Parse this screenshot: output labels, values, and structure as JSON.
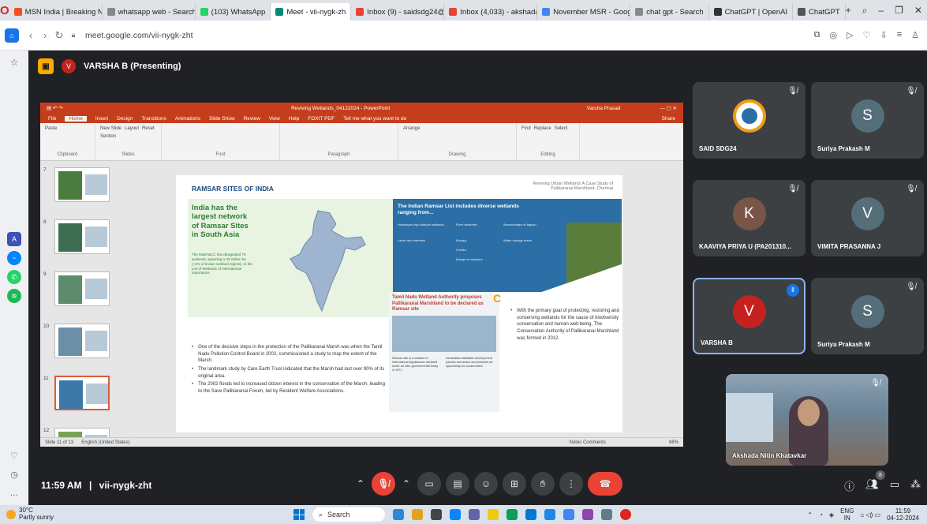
{
  "browser": {
    "tabs": [
      {
        "label": "MSN India | Breaking Ne",
        "color": "#f25022"
      },
      {
        "label": "whatsapp web - Search",
        "color": "#888888"
      },
      {
        "label": "(103) WhatsApp",
        "color": "#25d366"
      },
      {
        "label": "Meet - vii-nygk-zh",
        "color": "#00897b"
      },
      {
        "label": "Inbox (9) - saidsdg24@",
        "color": "#ea4335"
      },
      {
        "label": "Inbox (4,033) - akshada",
        "color": "#ea4335"
      },
      {
        "label": "November MSR - Goog",
        "color": "#4285f4"
      },
      {
        "label": "chat gpt - Search",
        "color": "#888888"
      },
      {
        "label": "ChatGPT | OpenAI",
        "color": "#333333"
      },
      {
        "label": "ChatGPT",
        "color": "#555555"
      }
    ],
    "url": "meet.google.com/vii-nygk-zht"
  },
  "presenting": {
    "initial": "V",
    "label": "VARSHA B (Presenting)"
  },
  "ppt": {
    "window_title": "Reviving Wetlands_04122024 - PowerPoint",
    "user": "Varsha Prasad",
    "menu": [
      "File",
      "Home",
      "Insert",
      "Design",
      "Transitions",
      "Animations",
      "Slide Show",
      "Review",
      "View",
      "Help",
      "FOXIT PDF",
      "Tell me what you want to do"
    ],
    "share": "Share",
    "ribbon_groups": [
      "Clipboard",
      "Slides",
      "Font",
      "Paragraph",
      "Drawing",
      "Editing"
    ],
    "ribbon_items": {
      "paste": "Paste",
      "new_slide": "New Slide",
      "layout": "Layout",
      "reset": "Reset",
      "section": "Section",
      "arrange": "Arrange",
      "find": "Find",
      "replace": "Replace",
      "select": "Select"
    },
    "thumb_numbers": [
      "7",
      "8",
      "9",
      "10",
      "11",
      "12"
    ],
    "status_left": "Slide 11 of 13",
    "status_lang": "English (United States)",
    "status_right": "Notes   Comments",
    "zoom": "86%"
  },
  "slide": {
    "title": "RAMSAR SITES OF INDIA",
    "credit": "Reviving Urban Wetland: A Case Study of Pallikaranai Marshland, Chennai",
    "green_head": "India has the largest network of Ramsar Sites in South Asia",
    "green_sub": "The MoEF&CC has designated 75 wetlands, spanning 1.33 million ha (~4% of known wetland regime), to the List of Wetlands of International Importance.",
    "blue_head": "The Indian Ramsar List includes diverse wetlands ranging from...",
    "blue_cols": [
      "Himalayan high-altitude wetlands",
      "River stretches",
      "Assemblages of lagoon",
      "Lakes and marshes",
      "Estuary",
      "Water storage areas",
      "Creeks",
      "Mangrove swamps"
    ],
    "tamil_head": "Tamil Nadu Wetland Authority proposes Pallikaranai Marshland to be declared as Ramsar site",
    "tamil_bul_left": "Ramsar site is a wetland of international significance declared under an inter-governmental treaty in 1971",
    "tamil_bul_right": "Declaration facilitates development policies and action and presents an opportunity for conservation",
    "right_text": "With the primary goal of protecting, restoring and conserving wetlands for the cause of biodiversity conservation and human well-being, The Conservation Authority of Pallikaranai Marshland was formed in 2012.",
    "bullets": [
      "One of the decisive steps in the protection of the Pallikaranai Marsh was when the Tamil Nadu Pollution Control Board in 2002, commissioned a study to map the extent of the Marsh.",
      "The landmark study by Care Earth Trust indicated that the Marsh had lost over 90% of its original area.",
      "The 2002 floods led to increased citizen interest in the conservation of the Marsh, leading to the Save Pallikaranai Forum, led by Resident Welfare Associations."
    ]
  },
  "participants": [
    {
      "name": "SAID SDG24",
      "initial": "",
      "color": "#ffffff"
    },
    {
      "name": "Suriya Prakash M",
      "initial": "S",
      "color": "#546e7a"
    },
    {
      "name": "KAAVIYA PRIYA U (PA201310...",
      "initial": "K",
      "color": "#795548"
    },
    {
      "name": "VIMITA PRASANNA J",
      "initial": "V",
      "color": "#546e7a"
    },
    {
      "name": "VARSHA B",
      "initial": "V",
      "color": "#c5221f"
    },
    {
      "name": "Suriya Prakash M",
      "initial": "S",
      "color": "#546e7a"
    }
  ],
  "self_view": {
    "name": "Akshada Nitin Khatavkar"
  },
  "meeting": {
    "time": "11:59 AM",
    "separator": "|",
    "code": "vii-nygk-zht",
    "people_count": "8"
  },
  "taskbar": {
    "temp": "30°C",
    "weather": "Partly sunny",
    "search": "Search",
    "lang": "ENG",
    "region": "IN",
    "time": "11:59",
    "date": "04-12-2024"
  }
}
